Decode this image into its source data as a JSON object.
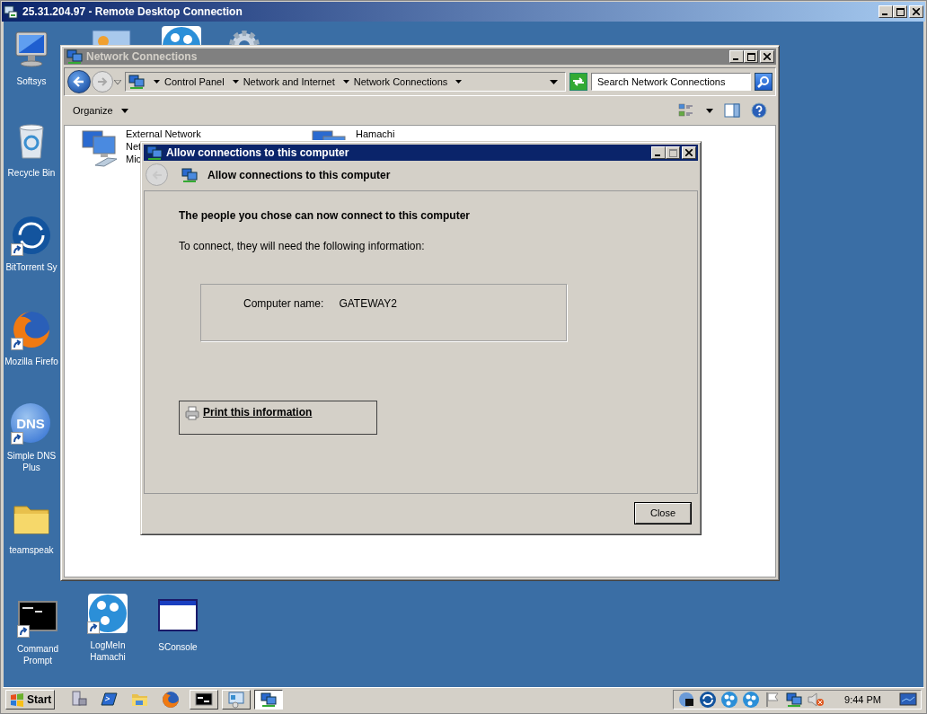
{
  "remote_window": {
    "title": "25.31.204.97 - Remote Desktop Connection"
  },
  "desktop_icons": [
    {
      "kind": "computer",
      "label": "Softsys",
      "shortcut": false
    },
    {
      "kind": "recycle",
      "label": "Recycle Bin",
      "shortcut": false
    },
    {
      "kind": "sync",
      "label": "BitTorrent Sy",
      "shortcut": true
    },
    {
      "kind": "firefox",
      "label": "Mozilla Firefo",
      "shortcut": true
    },
    {
      "kind": "dns",
      "label": "Simple DNS Plus",
      "badge": "DNS",
      "shortcut": true
    },
    {
      "kind": "folder",
      "label": "teamspeak",
      "shortcut": false
    },
    {
      "kind": "console",
      "label": "Command Prompt",
      "shortcut": true
    },
    {
      "kind": "hamachi",
      "label": "LogMeIn Hamachi",
      "shortcut": true
    },
    {
      "kind": "window",
      "label": "SConsole",
      "shortcut": false
    },
    {
      "kind": "panel"
    },
    {
      "kind": "hamachi"
    },
    {
      "kind": "gear"
    }
  ],
  "explorer": {
    "title": "Network Connections",
    "breadcrumbs": [
      "Control Panel",
      "Network and Internet",
      "Network Connections"
    ],
    "search": {
      "placeholder": "Search Network Connections"
    },
    "organize": "Organize",
    "connections": [
      {
        "lines": [
          "External Network",
          "Net",
          "Mic"
        ]
      },
      {
        "lines": [
          "Hamachi"
        ]
      }
    ]
  },
  "dialog": {
    "title": "Allow connections to this computer",
    "back_enabled": false,
    "heading": "Allow connections to this computer",
    "message": "The people you chose can now connect to this computer",
    "instruction": "To connect, they will need the following information:",
    "info": [
      {
        "label": "Computer name:",
        "value": "GATEWAY2"
      }
    ],
    "print_link": "Print this information",
    "buttons": [
      "Close"
    ]
  },
  "taskbar": {
    "start": "Start",
    "quick_launch": [
      {
        "kind": "server"
      },
      {
        "kind": "powershell"
      },
      {
        "kind": "folder"
      },
      {
        "kind": "firefox"
      }
    ],
    "tasks": [
      {
        "kind": "console",
        "selected": false
      },
      {
        "kind": "remote",
        "selected": false
      },
      {
        "kind": "network",
        "selected": true
      }
    ],
    "tray": [
      {
        "kind": "dns"
      },
      {
        "kind": "sync"
      },
      {
        "kind": "hamachi"
      },
      {
        "kind": "hamachi"
      },
      {
        "kind": "flag"
      },
      {
        "kind": "network"
      },
      {
        "kind": "speaker"
      }
    ],
    "clock": "9:44 PM"
  }
}
